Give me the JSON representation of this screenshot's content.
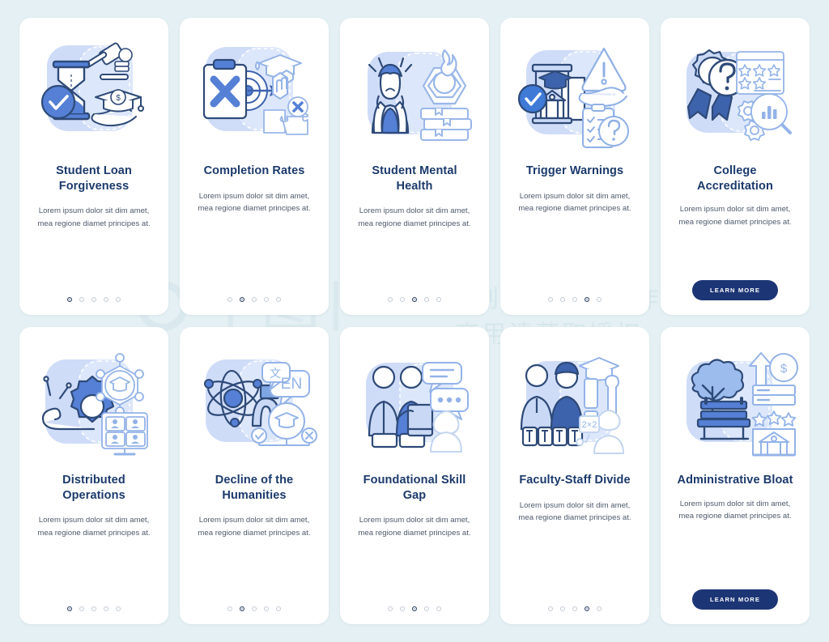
{
  "page": {
    "background_color": "#e4f0f3",
    "card_background": "#ffffff",
    "title_color": "#1b3a6b",
    "body_color": "#4e5a6b",
    "accent_blue": "#4a78d0",
    "light_blue": "#c9d9f5",
    "cta_color": "#1c3575",
    "dot_active_color": "#2a3f66",
    "dot_inactive_color": "#c3cbd6"
  },
  "watermark": {
    "mark": "千图",
    "line1": "营销创意服务与协作平台",
    "line2": "商用请获取授权"
  },
  "common": {
    "body_text": "Lorem ipsum dolor sit dim amet, mea regione diamet principes at.",
    "cta_label": "LEARN MORE",
    "dot_count": 5
  },
  "cards": [
    {
      "id": "student-loan-forgiveness",
      "title": "Student Loan Forgiveness",
      "body": "Lorem ipsum dolor sit dim amet, mea regione diamet principes at.",
      "icon": "hourglass-gavel-graduation-cap-icon",
      "active_dot": 1,
      "has_cta": false,
      "cta_label": ""
    },
    {
      "id": "completion-rates",
      "title": "Completion Rates",
      "body": "Lorem ipsum dolor sit dim amet, mea regione diamet principes at.",
      "icon": "clipboard-cross-target-puzzle-icon",
      "active_dot": 2,
      "has_cta": false,
      "cta_label": ""
    },
    {
      "id": "student-mental-health",
      "title": "Student Mental Health",
      "body": "Lorem ipsum dolor sit dim amet, mea regione diamet principes at.",
      "icon": "stressed-student-burnout-books-icon",
      "active_dot": 3,
      "has_cta": false,
      "cta_label": ""
    },
    {
      "id": "trigger-warnings",
      "title": "Trigger Warnings",
      "body": "Lorem ipsum dolor sit dim amet, mea regione diamet principes at.",
      "icon": "campus-warning-checklist-question-icon",
      "active_dot": 4,
      "has_cta": false,
      "cta_label": ""
    },
    {
      "id": "college-accreditation",
      "title": "College Accreditation",
      "body": "Lorem ipsum dolor sit dim amet, mea regione diamet principes at.",
      "icon": "award-ribbon-question-rating-chart-icon",
      "active_dot": 5,
      "has_cta": true,
      "cta_label": "LEARN MORE"
    },
    {
      "id": "distributed-operations",
      "title": "Distributed Operations",
      "body": "Lorem ipsum dolor sit dim amet, mea regione diamet principes at.",
      "icon": "snail-gear-network-video-grid-icon",
      "active_dot": 1,
      "has_cta": false,
      "cta_label": ""
    },
    {
      "id": "decline-of-the-humanities",
      "title": "Decline of the Humanities",
      "body": "Lorem ipsum dolor sit dim amet, mea regione diamet principes at.",
      "icon": "atom-magnet-language-graduation-icon",
      "active_dot": 2,
      "has_cta": false,
      "cta_label": ""
    },
    {
      "id": "foundational-skill-gap",
      "title": "Foundational Skill Gap",
      "body": "Lorem ipsum dolor sit dim amet, mea regione diamet principes at.",
      "icon": "students-tablet-speech-bubbles-icon",
      "active_dot": 3,
      "has_cta": false,
      "cta_label": ""
    },
    {
      "id": "faculty-staff-divide",
      "title": "Faculty-Staff Divide",
      "body": "Lorem ipsum dolor sit dim amet, mea regione diamet principes at.",
      "icon": "worker-professor-wrench-math-icon",
      "active_dot": 4,
      "has_cta": false,
      "cta_label": ""
    },
    {
      "id": "administrative-bloat",
      "title": "Administrative Bloat",
      "body": "Lorem ipsum dolor sit dim amet, mea regione diamet principes at.",
      "icon": "campus-bench-tree-money-growth-icon",
      "active_dot": 5,
      "has_cta": true,
      "cta_label": "LEARN MORE"
    }
  ]
}
